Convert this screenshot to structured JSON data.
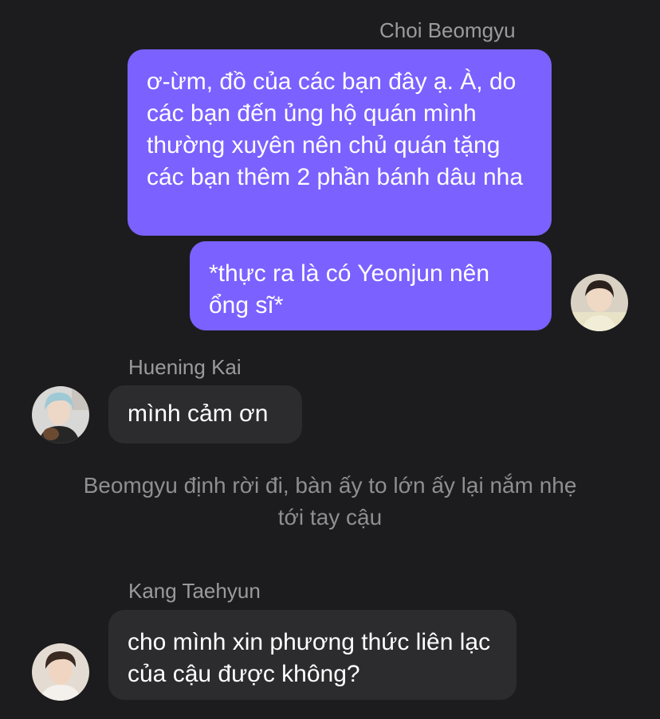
{
  "messages": [
    {
      "sender": "Choi Beomgyu",
      "text": "ơ-ừm, đồ của các bạn đây ạ. À, do các bạn đến ủng hộ quán mình thường xuyên nên chủ quán tặng các bạn thêm 2 phần bánh dâu nha"
    },
    {
      "text": "*thực ra là có Yeonjun nên ổng sĩ*"
    },
    {
      "sender": "Huening Kai",
      "text": "mình cảm ơn"
    },
    {
      "narration": "Beomgyu định rời đi, bàn ấy to lớn ấy lại nắm nhẹ tới tay cậu"
    },
    {
      "sender": "Kang Taehyun",
      "text": "cho mình xin phương thức liên lạc của cậu được không?"
    }
  ],
  "colors": {
    "background": "#1c1c1e",
    "outgoing_bubble": "#7b61ff",
    "incoming_bubble": "#2c2c2e",
    "sender_name": "#9a9a9f",
    "narration": "#8e8e93"
  }
}
